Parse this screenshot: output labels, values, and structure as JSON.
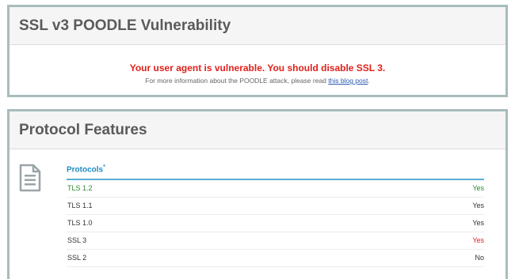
{
  "poodle": {
    "title": "SSL v3 POODLE Vulnerability",
    "warning": "Your user agent is vulnerable. You should disable SSL 3.",
    "info_prefix": "For more information about the POODLE attack, please read ",
    "link_text": "this blog post",
    "info_suffix": "."
  },
  "protocol_features": {
    "title": "Protocol Features",
    "table_title": "Protocols",
    "footnote_mark": "*",
    "icon": "document-icon",
    "rows": [
      {
        "name": "TLS 1.2",
        "value": "Yes",
        "color": "#2a8a2a"
      },
      {
        "name": "TLS 1.1",
        "value": "Yes",
        "color": "#333333"
      },
      {
        "name": "TLS 1.0",
        "value": "Yes",
        "color": "#333333"
      },
      {
        "name": "SSL 3",
        "value": "Yes",
        "color": "#e0201b"
      },
      {
        "name": "SSL 2",
        "value": "No",
        "color": "#333333"
      }
    ]
  },
  "colors": {
    "panel_border": "#a8bcbc",
    "warning": "#e0201b",
    "ok": "#2a8a2a",
    "accent": "#1e8bc3"
  }
}
